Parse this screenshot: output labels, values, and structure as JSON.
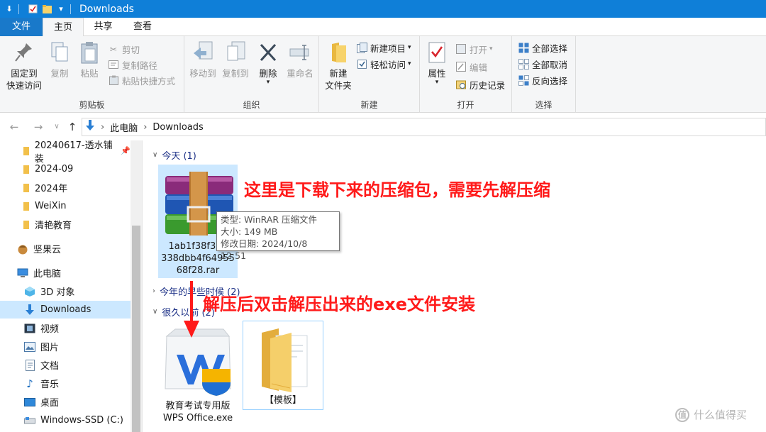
{
  "window": {
    "title": "Downloads"
  },
  "ribbon_tabs": [
    "文件",
    "主页",
    "共享",
    "查看"
  ],
  "ribbon": {
    "clipboard": {
      "pin_line1": "固定到",
      "pin_line2": "快速访问",
      "copy": "复制",
      "paste": "粘贴",
      "cut": "剪切",
      "copy_path": "复制路径",
      "paste_shortcut": "粘贴快捷方式",
      "label": "剪贴板"
    },
    "organize": {
      "move_to": "移动到",
      "copy_to": "复制到",
      "delete": "删除",
      "rename": "重命名",
      "label": "组织"
    },
    "new": {
      "new_folder_line1": "新建",
      "new_folder_line2": "文件夹",
      "new_item": "新建项目",
      "easy_access": "轻松访问",
      "label": "新建"
    },
    "open": {
      "properties": "属性",
      "open": "打开",
      "edit": "编辑",
      "history": "历史记录",
      "label": "打开"
    },
    "select": {
      "select_all": "全部选择",
      "select_none": "全部取消",
      "invert": "反向选择",
      "label": "选择"
    }
  },
  "address": {
    "crumbs": [
      "此电脑",
      "Downloads"
    ]
  },
  "sidebar": {
    "items": [
      {
        "label": "20240617-透水铺装"
      },
      {
        "label": "2024-09"
      },
      {
        "label": "2024年"
      },
      {
        "label": "WeiXin"
      },
      {
        "label": "清艳教育"
      },
      {
        "label": "坚果云"
      },
      {
        "label": "此电脑"
      },
      {
        "label": "3D 对象"
      },
      {
        "label": "Downloads"
      },
      {
        "label": "视频"
      },
      {
        "label": "图片"
      },
      {
        "label": "文档"
      },
      {
        "label": "音乐"
      },
      {
        "label": "桌面"
      },
      {
        "label": "Windows-SSD (C:)"
      }
    ]
  },
  "groups": {
    "today": "今天 (1)",
    "earlier_this_year": "今年的早些时候 (2)",
    "long_ago": "很久以前 (2)"
  },
  "files": {
    "rar": {
      "line1": "1ab1f38f3a8",
      "line2": "338dbb4f64955",
      "line3": "68f28.rar"
    },
    "exe": {
      "line1": "教育考试专用版",
      "line2": "WPS Office.exe"
    },
    "folder": {
      "name": "【模板】"
    }
  },
  "tooltip": {
    "type": "类型: WinRAR 压缩文件",
    "size": "大小: 149 MB",
    "modified": "修改日期: 2024/10/8 12:51"
  },
  "annotations": {
    "top": "这里是下载下来的压缩包，需要先解压缩",
    "bottom": "解压后双击解压出来的exe文件安装"
  },
  "watermark": {
    "text": "什么值得买",
    "logo": "值"
  },
  "colors": {
    "titlebar": "#0f7fd8",
    "selection": "#cce8ff",
    "annotation": "#ff1a1a"
  }
}
